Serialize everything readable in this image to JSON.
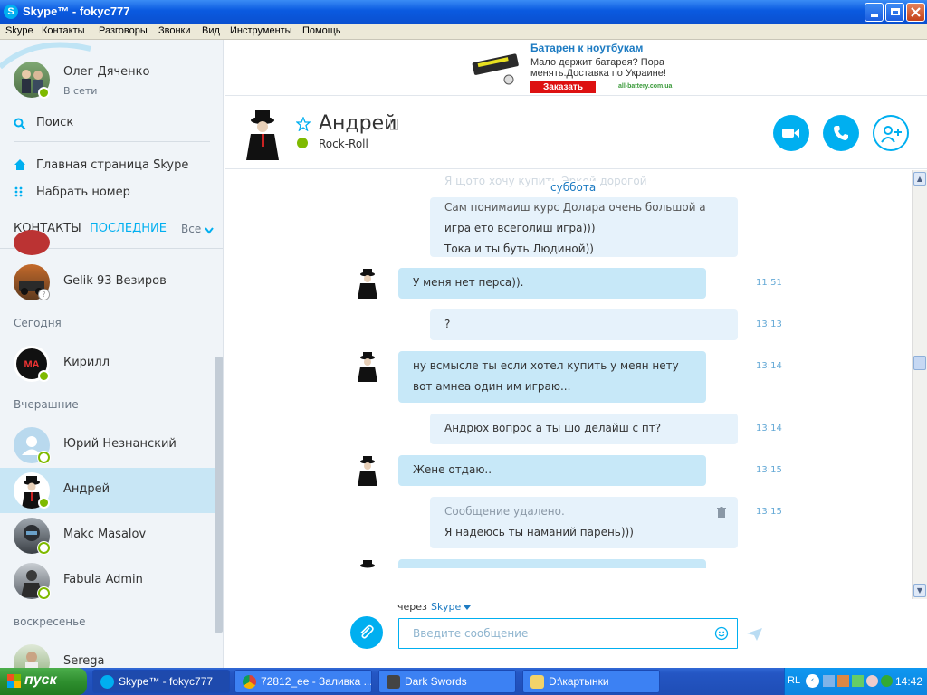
{
  "window": {
    "title": "Skype™ - fokyc777",
    "logo": "S"
  },
  "menu": [
    "Skype",
    "Контакты",
    "Разговоры",
    "Звонки",
    "Вид",
    "Инструменты",
    "Помощь"
  ],
  "profile": {
    "name": "Олег Дяченко",
    "status": "В сети"
  },
  "sidebar": {
    "search_label": "Поиск",
    "home_label": "Главная страница Skype",
    "dial_label": "Набрать номер",
    "tab_contacts": "КОНТАКТЫ",
    "tab_recent": "ПОСЛЕДНИЕ",
    "filter": "Все",
    "sections": {
      "today": "Сегодня",
      "yesterday": "Вчерашние",
      "sunday": "воскресенье"
    },
    "contacts": [
      {
        "name": "Gelik 93 Везиров",
        "status": "unknown"
      },
      {
        "name": "Кирилл",
        "status": "online"
      },
      {
        "name": "Юрий Незнанский",
        "status": "offline"
      },
      {
        "name": "Андрей",
        "status": "online"
      },
      {
        "name": "Makc Masalov",
        "status": "offline"
      },
      {
        "name": "Fabula Admin",
        "status": "offline"
      },
      {
        "name": "Serega",
        "status": "offline"
      }
    ]
  },
  "ad": {
    "title": "Батарен к ноутбукам",
    "line1": "Мало держит батарея? Пора",
    "line2": "менять.Доставка по Украине!",
    "button": "Заказать",
    "site": "all-battery.com.ua"
  },
  "conversation": {
    "name": "Андрей",
    "mood": "Rock-Roll"
  },
  "chat": {
    "date_marker": "суббота",
    "faded_top": "Я щото хочу купить Эркой дорогой",
    "messages": [
      {
        "dir": "out",
        "lines": [
          "Сам понимаиш курс Долара очень большой а",
          "игра ето всеголиш игра)))",
          "Тока и ты буть Людиной))"
        ],
        "time": ""
      },
      {
        "dir": "in",
        "lines": [
          "У меня нет перса))."
        ],
        "time": "11:51"
      },
      {
        "dir": "out",
        "lines": [
          "?"
        ],
        "time": "13:13"
      },
      {
        "dir": "in",
        "lines": [
          "ну всмысле ты если хотел купить у меян нету",
          "вот амнеа один им играю..."
        ],
        "time": "13:14"
      },
      {
        "dir": "out",
        "lines": [
          "Андрюх вопрос а ты шо делайш с пт?"
        ],
        "time": "13:14"
      },
      {
        "dir": "in",
        "lines": [
          "Жене отдаю.."
        ],
        "time": "13:15"
      },
      {
        "dir": "out",
        "deleted": "Сообщение удалено.",
        "lines": [
          "Я надеюсь ты наманий парень)))"
        ],
        "time": "13:15"
      }
    ]
  },
  "composer": {
    "via": "через",
    "via_service": "Skype",
    "placeholder": "Введите сообщение"
  },
  "taskbar": {
    "start": "пуск",
    "tasks": [
      "Skype™ - fokyc777",
      "72812_ee - Заливка ...",
      "Dark Swords",
      "D:\\картынки"
    ],
    "lang": "RL",
    "clock": "14:42"
  }
}
